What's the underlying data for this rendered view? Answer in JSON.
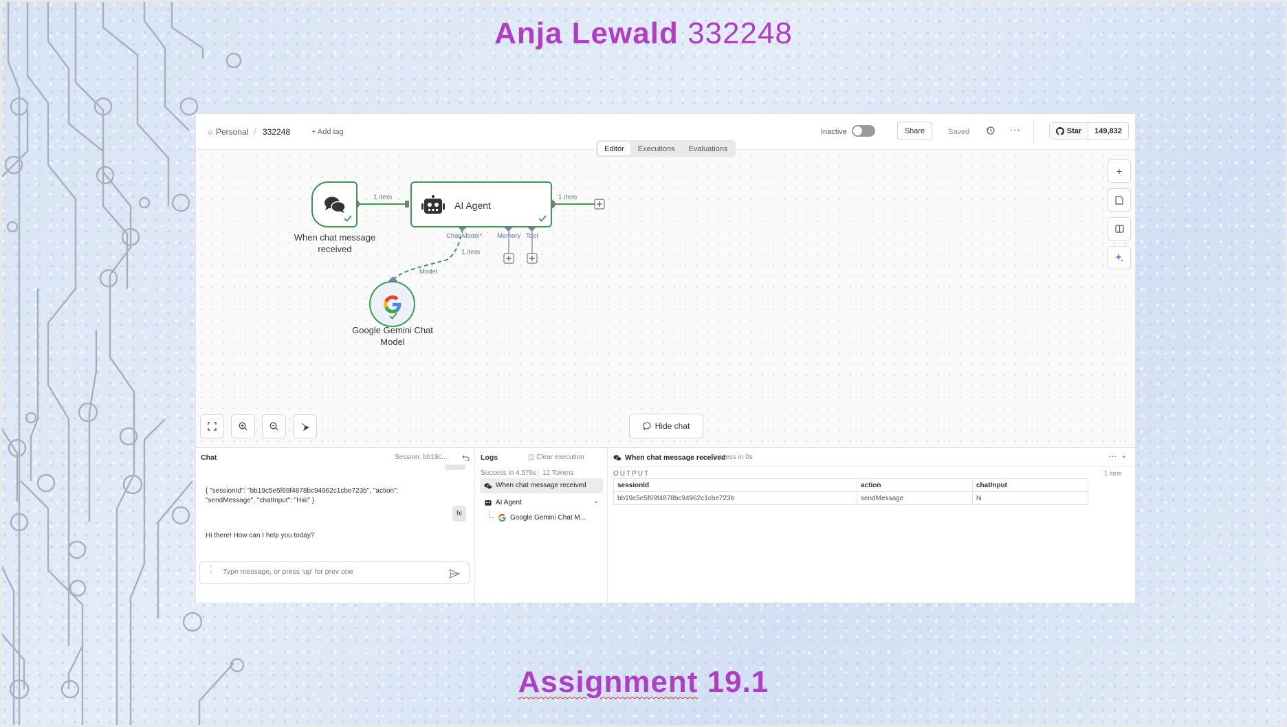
{
  "slide": {
    "title_name": "Anja Lewald",
    "title_number": "332248",
    "footer_word": "Assignment",
    "footer_number": "19.1"
  },
  "topbar": {
    "project": "Personal",
    "workflow_name": "332248",
    "add_tag": "+ Add tag",
    "status_label": "Inactive",
    "share_label": "Share",
    "saved_label": "Saved",
    "more_label": "···",
    "github_star_label": "Star",
    "github_star_count": "149,832"
  },
  "tabs": [
    {
      "label": "Editor",
      "active": true
    },
    {
      "label": "Executions",
      "active": false
    },
    {
      "label": "Evaluations",
      "active": false
    }
  ],
  "canvas": {
    "trigger_node": {
      "label": "When chat message received"
    },
    "agent_node": {
      "label": "AI Agent"
    },
    "model_node": {
      "label": "Google Gemini Chat Model"
    },
    "connections": {
      "trigger_to_agent": "1 item",
      "agent_output": "1 item",
      "model_to_agent": "1 item"
    },
    "ports": {
      "chat_model": "Chat Model",
      "required_mark": "*",
      "memory": "Memory",
      "tool": "Tool",
      "model": "Model"
    },
    "hide_chat_label": "Hide chat",
    "colors": {
      "success": "#2e9b4f",
      "sub_port": "#7b7fb9",
      "accent": "#b03ec4"
    }
  },
  "chat": {
    "header": "Chat",
    "session": "Session: bb19c...",
    "messages": [
      {
        "role": "user",
        "text": "{ \"sessionId\": \"bb19c5e5f69f4878bc94962c1cbe723b\", \"action\": \"sendMessage\", \"chatInput\": \"Hiiii\" }"
      },
      {
        "role": "user",
        "text": "hi"
      },
      {
        "role": "bot",
        "text": "Hi there! How can I help you today?"
      }
    ],
    "input_placeholder": "Type message, or press 'up' for prev one"
  },
  "logs": {
    "header": "Logs",
    "clear_label": "Clear execution",
    "summary_time": "Success in 4.576s",
    "summary_tokens": "12 Tokens",
    "entries": [
      {
        "label": "When chat message received"
      },
      {
        "label": "AI Agent"
      },
      {
        "label": "Google Gemini Chat M..."
      }
    ]
  },
  "output": {
    "node_title": "When chat message received",
    "node_status": "Success in 0s",
    "section_label": "OUTPUT",
    "item_count": "1 item",
    "columns": [
      "sessionId",
      "action",
      "chatInput"
    ],
    "rows": [
      [
        "bb19c5e5f69f4878bc94962c1cbe723b",
        "sendMessage",
        "hi"
      ]
    ]
  }
}
